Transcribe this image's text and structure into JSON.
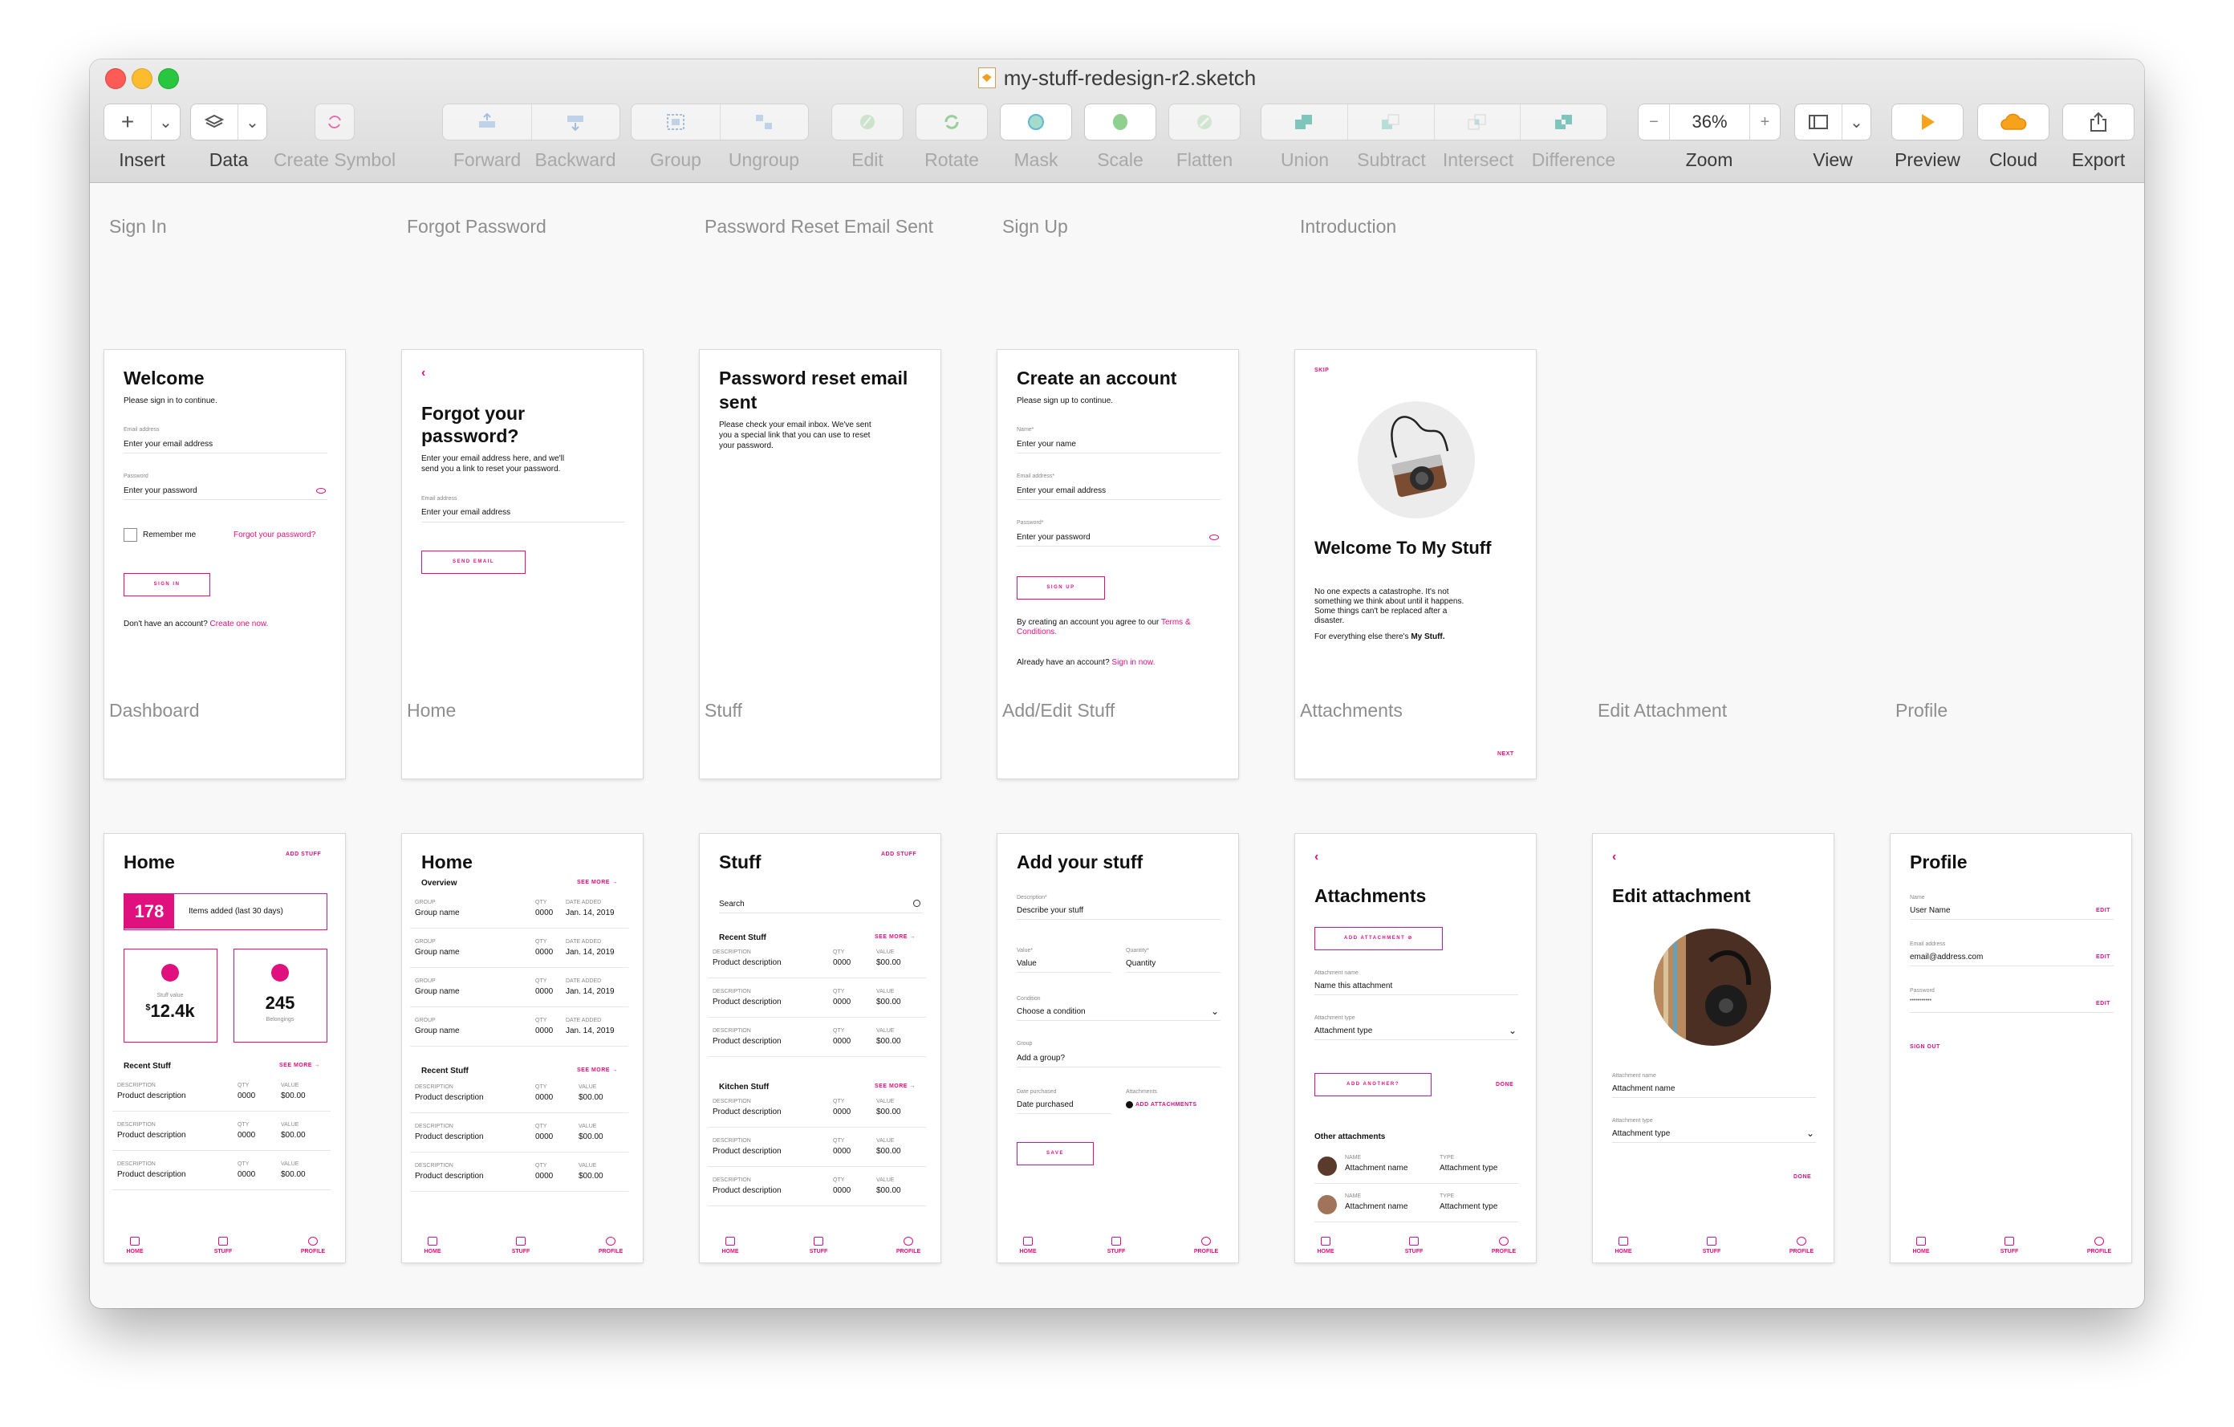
{
  "window": {
    "title": "my-stuff-redesign-r2.sketch"
  },
  "toolbar": {
    "insert": "Insert",
    "data": "Data",
    "create_symbol": "Create Symbol",
    "forward": "Forward",
    "backward": "Backward",
    "group": "Group",
    "ungroup": "Ungroup",
    "edit": "Edit",
    "rotate": "Rotate",
    "mask": "Mask",
    "scale": "Scale",
    "flatten": "Flatten",
    "union": "Union",
    "subtract": "Subtract",
    "intersect": "Intersect",
    "difference": "Difference",
    "zoom": "Zoom",
    "zoom_value": "36%",
    "view": "View",
    "preview": "Preview",
    "cloud": "Cloud",
    "export": "Export",
    "plus": "+",
    "minus": "−",
    "chev": "⌄"
  },
  "artboards": {
    "signin": {
      "label": "Sign In",
      "title": "Welcome",
      "sub": "Please sign in to continue.",
      "email_label": "Email address",
      "email_ph": "Enter your email address",
      "pw_label": "Password",
      "pw_ph": "Enter your password",
      "remember": "Remember me",
      "forgot": "Forgot your password?",
      "button": "SIGN IN",
      "noacct": "Don't have an account?",
      "create": "Create one now."
    },
    "forgot": {
      "label": "Forgot Password",
      "title1": "Forgot your",
      "title2": "password?",
      "desc1": "Enter your email address here, and we'll",
      "desc2": "send you a link to reset your password.",
      "email_label": "Email address",
      "email_ph": "Enter your email address",
      "button": "SEND EMAIL"
    },
    "reset": {
      "label": "Password Reset Email Sent",
      "title1": "Password reset email",
      "title2": "sent",
      "d1": "Please check your email inbox. We've sent",
      "d2": "you a special link that you can use to reset",
      "d3": "your password."
    },
    "signup": {
      "label": "Sign Up",
      "title": "Create an account",
      "sub": "Please sign up to continue.",
      "name_label": "Name*",
      "name_ph": "Enter your name",
      "email_label": "Email address*",
      "email_ph": "Enter your email address",
      "pw_label": "Password*",
      "pw_ph": "Enter your password",
      "button": "SIGN UP",
      "terms1": "By creating an account you agree to our",
      "terms_link1": "Terms &",
      "terms_link2": "Conditions.",
      "have": "Already have an account?",
      "signin": "Sign in now."
    },
    "intro": {
      "label": "Introduction",
      "skip": "SKIP",
      "title": "Welcome To My Stuff",
      "p1": "No one expects a catastrophe. It's not",
      "p2": "something we think about until it happens.",
      "p3": "Some things can't be replaced after a",
      "p4": "disaster.",
      "p5a": "For everything else there's",
      "p5b": "My Stuff.",
      "next": "NEXT"
    },
    "dashboard": {
      "label": "Dashboard",
      "title": "Home",
      "add": "ADD STUFF",
      "count": "178",
      "count_label": "Items added (last 30 days)",
      "value_label": "Stuff value",
      "value_cur": "$",
      "value": "12.4k",
      "bel": "245",
      "bel_label": "Belongings",
      "recent": "Recent Stuff",
      "see": "SEE MORE →"
    },
    "home": {
      "label": "Home",
      "title": "Home",
      "overview": "Overview",
      "see": "SEE MORE →",
      "recent": "Recent Stuff"
    },
    "stuff": {
      "label": "Stuff",
      "title": "Stuff",
      "add": "ADD STUFF",
      "search": "Search",
      "recent": "Recent Stuff",
      "kitchen": "Kitchen Stuff",
      "see": "SEE MORE →"
    },
    "addedit": {
      "label": "Add/Edit Stuff",
      "title": "Add your stuff",
      "desc_label": "Description*",
      "desc_ph": "Describe your stuff",
      "value_label": "Value*",
      "value_ph": "Value",
      "qty_label": "Quantity*",
      "qty_ph": "Quantity",
      "cond_label": "Condition",
      "cond_ph": "Choose a condition",
      "group_label": "Group",
      "group_ph": "Add a group?",
      "date_label": "Date purchased",
      "date_ph": "Date purchased",
      "att_label": "Attachments",
      "att_link": "ADD ATTACHMENTS",
      "button": "SAVE"
    },
    "attach": {
      "label": "Attachments",
      "title": "Attachments",
      "add_button": "ADD ATTACHMENT ⊘",
      "name_label": "Attachment name",
      "name_ph": "Name this attachment",
      "type_label": "Attachment type",
      "type_ph": "Attachment type",
      "another": "ADD ANOTHER?",
      "done": "DONE",
      "other": "Other attachments",
      "col_name": "NAME",
      "col_type": "TYPE",
      "row_name": "Attachment name",
      "row_type": "Attachment type"
    },
    "editatt": {
      "label": "Edit Attachment",
      "title": "Edit attachment",
      "name_label": "Attachment name",
      "name_ph": "Attachment name",
      "type_label": "Attachment type",
      "type_ph": "Attachment type",
      "done": "DONE"
    },
    "profile": {
      "label": "Profile",
      "title": "Profile",
      "name_label": "Name",
      "name_val": "User Name",
      "email_label": "Email address",
      "email_val": "email@address.com",
      "pw_label": "Password",
      "pw_val": "•••••••••••",
      "edit": "EDIT",
      "signout": "SIGN OUT"
    }
  },
  "table": {
    "desc": "DESCRIPTION",
    "qty": "QTY",
    "value": "VALUE",
    "group": "GROUP",
    "date": "DATE ADDED",
    "product": "Product description",
    "qty_val": "0000",
    "val": "$00.00",
    "group_name": "Group name",
    "date_val": "Jan. 14, 2019"
  },
  "nav": {
    "home": "HOME",
    "stuff": "STUFF",
    "profile": "PROFILE"
  }
}
